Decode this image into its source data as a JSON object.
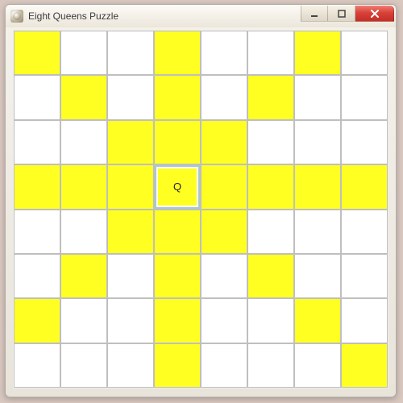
{
  "window": {
    "title": "Eight Queens Puzzle"
  },
  "board": {
    "size": 8,
    "queen_label": "Q",
    "queens": [
      {
        "row": 3,
        "col": 3
      }
    ],
    "attacked": [
      [
        0,
        0
      ],
      [
        0,
        3
      ],
      [
        0,
        6
      ],
      [
        1,
        1
      ],
      [
        1,
        3
      ],
      [
        1,
        5
      ],
      [
        2,
        2
      ],
      [
        2,
        3
      ],
      [
        2,
        4
      ],
      [
        3,
        0
      ],
      [
        3,
        1
      ],
      [
        3,
        2
      ],
      [
        3,
        4
      ],
      [
        3,
        5
      ],
      [
        3,
        6
      ],
      [
        3,
        7
      ],
      [
        4,
        2
      ],
      [
        4,
        3
      ],
      [
        4,
        4
      ],
      [
        5,
        1
      ],
      [
        5,
        3
      ],
      [
        5,
        5
      ],
      [
        6,
        0
      ],
      [
        6,
        3
      ],
      [
        6,
        6
      ],
      [
        7,
        3
      ],
      [
        7,
        7
      ]
    ]
  },
  "colors": {
    "attacked": "#ffff22",
    "empty": "#ffffff",
    "grid_line": "#bfbfbf"
  }
}
